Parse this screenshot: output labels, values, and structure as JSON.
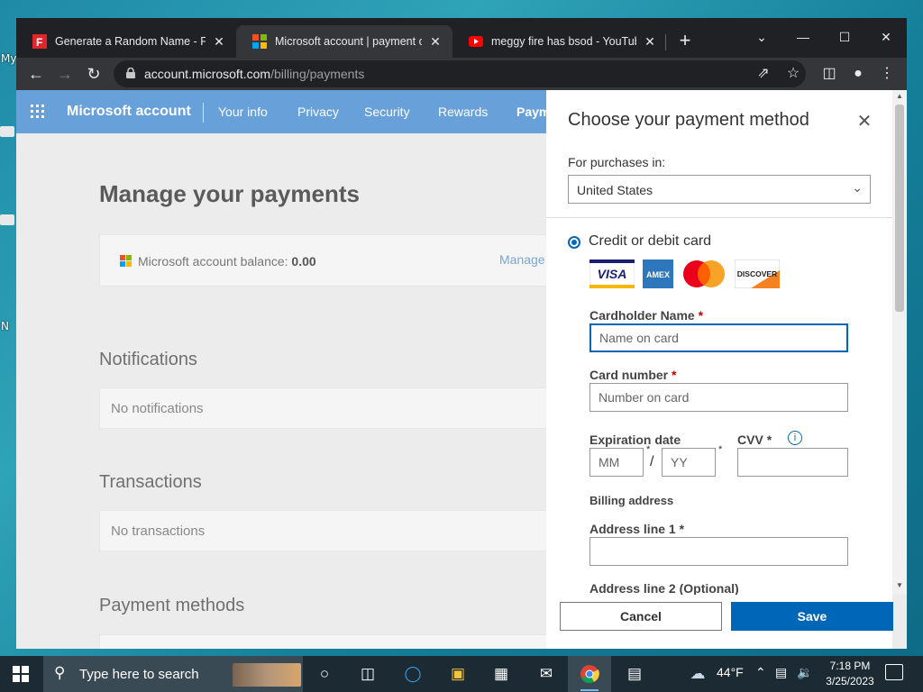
{
  "desktop": {
    "labels": [
      "My",
      "N"
    ]
  },
  "browser": {
    "tabs": [
      {
        "title": "Generate a Random Name - Fake",
        "close": "✕"
      },
      {
        "title": "Microsoft account | payment opt",
        "close": "✕"
      },
      {
        "title": "meggy fire has bsod - YouTube",
        "close": "✕"
      }
    ],
    "new_tab": "+",
    "url_host": "account.microsoft.com",
    "url_path": "/billing/payments"
  },
  "page": {
    "nav": {
      "brand": "Microsoft account",
      "links": [
        "Your info",
        "Privacy",
        "Security",
        "Rewards",
        "Paym"
      ]
    },
    "title": "Manage your payments",
    "balance": {
      "label": "Microsoft account balance: ",
      "value": "0.00",
      "manage": "Manage"
    },
    "notifications": {
      "heading": "Notifications",
      "empty": "No notifications"
    },
    "transactions": {
      "heading": "Transactions",
      "empty": "No transactions"
    },
    "payment_methods": {
      "heading": "Payment methods"
    }
  },
  "panel": {
    "title": "Choose your payment method",
    "purchases_label": "For purchases in:",
    "country": "United States",
    "method_label": "Credit or debit card",
    "card_logos": [
      "VISA",
      "AMEX",
      "Mastercard",
      "DISCOVER"
    ],
    "cardholder_label": "Cardholder Name ",
    "cardholder_placeholder": "Name on card",
    "card_number_label": "Card number ",
    "card_number_placeholder": "Number on card",
    "expiration_label": "Expiration date",
    "mm_placeholder": "MM",
    "yy_placeholder": "YY",
    "slash": "/",
    "cvv_label": "CVV ",
    "required_mark": "*",
    "billing_heading": "Billing address",
    "address1_label": "Address line 1 ",
    "address2_label": "Address line 2 (Optional)",
    "cancel": "Cancel",
    "save": "Save"
  },
  "taskbar": {
    "search_placeholder": "Type here to search",
    "weather": "44°F",
    "time": "7:18 PM",
    "date": "3/25/2023"
  },
  "colors": {
    "ms_blue": "#68a1d9",
    "accent": "#0067b8"
  }
}
